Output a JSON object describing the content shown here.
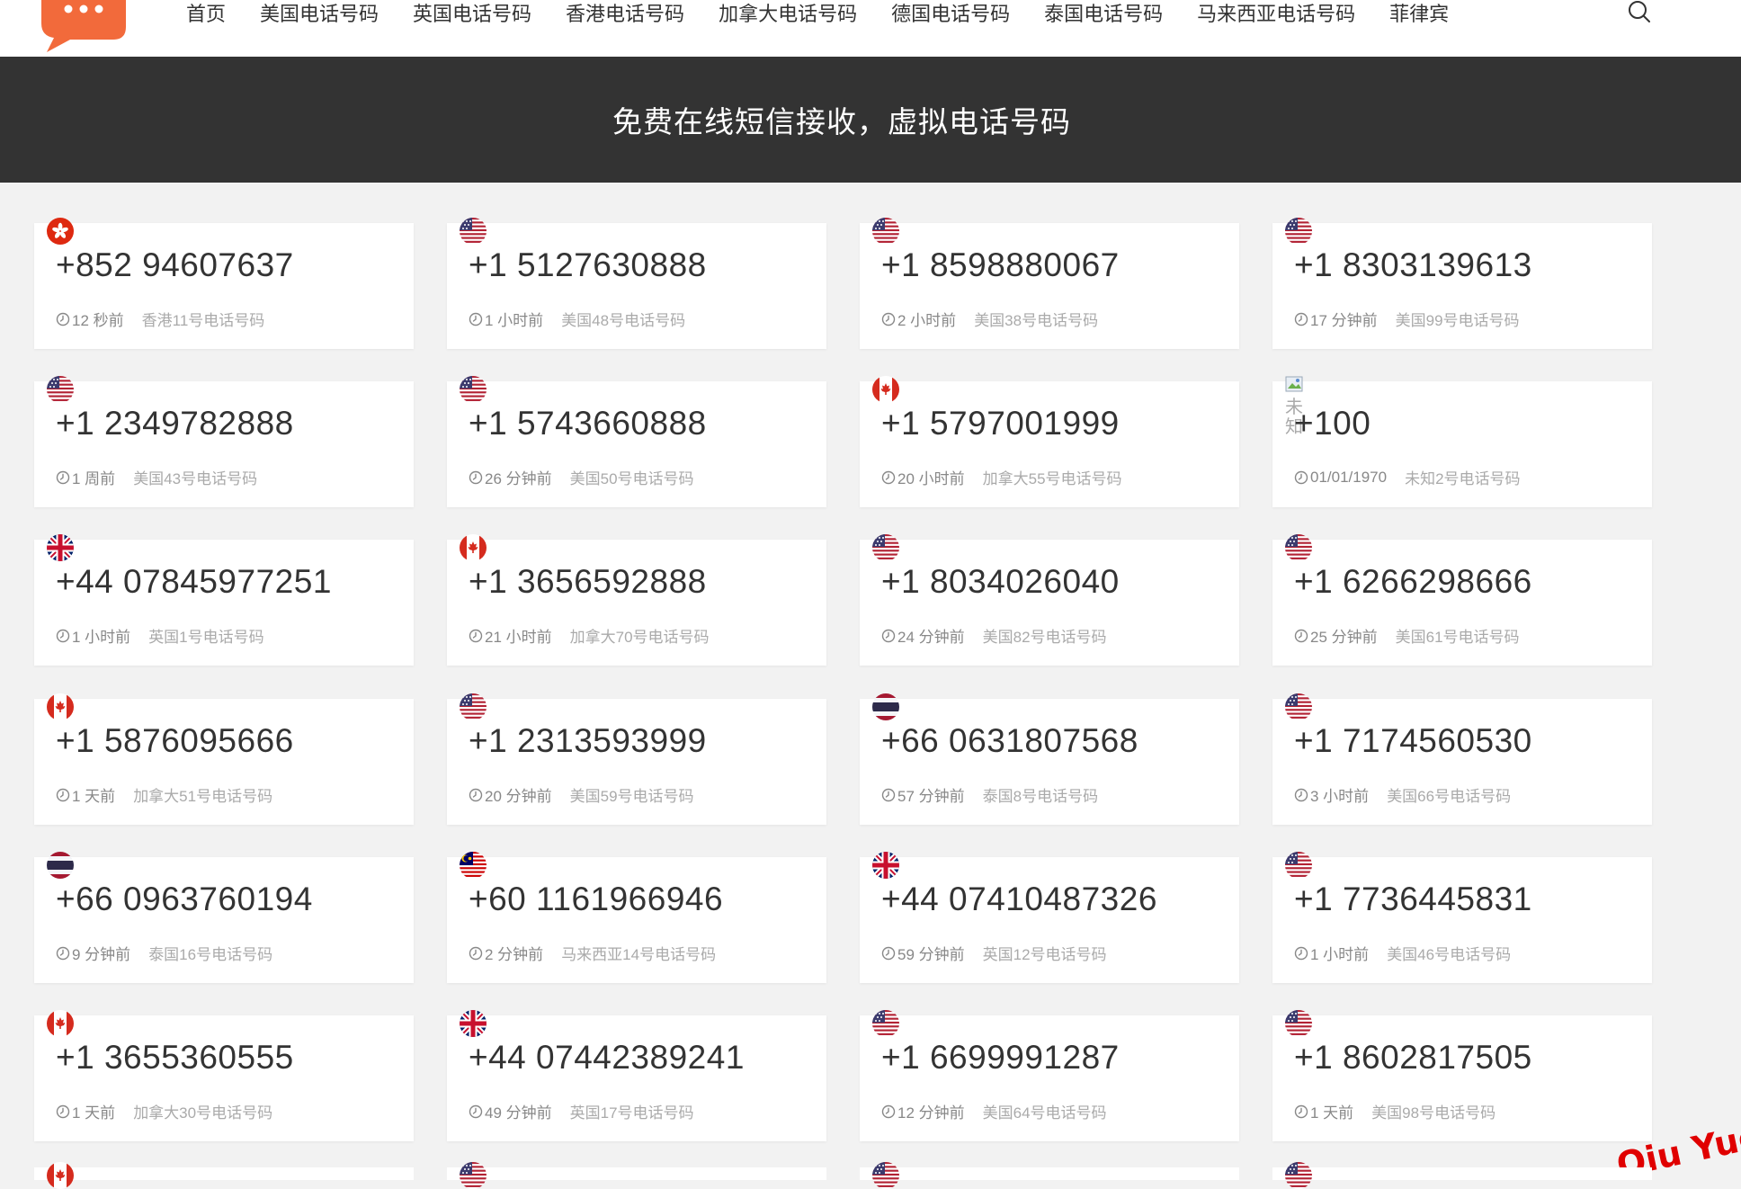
{
  "nav": {
    "items": [
      "首页",
      "美国电话号码",
      "英国电话号码",
      "香港电话号码",
      "加拿大电话号码",
      "德国电话号码",
      "泰国电话号码",
      "马来西亚电话号码",
      "菲律宾"
    ]
  },
  "banner": {
    "title": "免费在线短信接收，虚拟电话号码"
  },
  "cards": [
    {
      "flag": "hk-flag-icon",
      "number": "+852 94607637",
      "time": "12 秒前",
      "label": "香港11号电话号码"
    },
    {
      "flag": "us-flag-icon",
      "number": "+1 5127630888",
      "time": "1 小时前",
      "label": "美国48号电话号码"
    },
    {
      "flag": "us-flag-icon",
      "number": "+1 8598880067",
      "time": "2 小时前",
      "label": "美国38号电话号码"
    },
    {
      "flag": "us-flag-icon",
      "number": "+1 8303139613",
      "time": "17 分钟前",
      "label": "美国99号电话号码"
    },
    {
      "flag": "us-flag-icon",
      "number": "+1 2349782888",
      "time": "1 周前",
      "label": "美国43号电话号码"
    },
    {
      "flag": "us-flag-icon",
      "number": "+1 5743660888",
      "time": "26 分钟前",
      "label": "美国50号电话号码"
    },
    {
      "flag": "ca-flag-icon",
      "number": "+1 5797001999",
      "time": "20 小时前",
      "label": "加拿大55号电话号码"
    },
    {
      "flag": "unknown-flag-icon",
      "number": "+100",
      "time": "01/01/1970",
      "label": "未知2号电话号码",
      "flag_alt": "未知"
    },
    {
      "flag": "uk-flag-icon",
      "number": "+44 07845977251",
      "time": "1 小时前",
      "label": "英国1号电话号码"
    },
    {
      "flag": "ca-flag-icon",
      "number": "+1 3656592888",
      "time": "21 小时前",
      "label": "加拿大70号电话号码"
    },
    {
      "flag": "us-flag-icon",
      "number": "+1 8034026040",
      "time": "24 分钟前",
      "label": "美国82号电话号码"
    },
    {
      "flag": "us-flag-icon",
      "number": "+1 6266298666",
      "time": "25 分钟前",
      "label": "美国61号电话号码"
    },
    {
      "flag": "ca-flag-icon",
      "number": "+1 5876095666",
      "time": "1 天前",
      "label": "加拿大51号电话号码"
    },
    {
      "flag": "us-flag-icon",
      "number": "+1 2313593999",
      "time": "20 分钟前",
      "label": "美国59号电话号码"
    },
    {
      "flag": "th-flag-icon",
      "number": "+66 0631807568",
      "time": "57 分钟前",
      "label": "泰国8号电话号码"
    },
    {
      "flag": "us-flag-icon",
      "number": "+1 7174560530",
      "time": "3 小时前",
      "label": "美国66号电话号码"
    },
    {
      "flag": "th-flag-icon",
      "number": "+66 0963760194",
      "time": "9 分钟前",
      "label": "泰国16号电话号码"
    },
    {
      "flag": "my-flag-icon",
      "number": "+60 1161966946",
      "time": "2 分钟前",
      "label": "马来西亚14号电话号码"
    },
    {
      "flag": "uk-flag-icon",
      "number": "+44 07410487326",
      "time": "59 分钟前",
      "label": "英国12号电话号码"
    },
    {
      "flag": "us-flag-icon",
      "number": "+1 7736445831",
      "time": "1 小时前",
      "label": "美国46号电话号码"
    },
    {
      "flag": "ca-flag-icon",
      "number": "+1 3655360555",
      "time": "1 天前",
      "label": "加拿大30号电话号码"
    },
    {
      "flag": "uk-flag-icon",
      "number": "+44 07442389241",
      "time": "49 分钟前",
      "label": "英国17号电话号码"
    },
    {
      "flag": "us-flag-icon",
      "number": "+1 6699991287",
      "time": "12 分钟前",
      "label": "美国64号电话号码"
    },
    {
      "flag": "us-flag-icon",
      "number": "+1 8602817505",
      "time": "1 天前",
      "label": "美国98号电话号码"
    }
  ],
  "partial_row_flags": [
    "ca-flag-icon",
    "us-flag-icon",
    "us-flag-icon",
    "us-flag-icon"
  ],
  "watermark": {
    "text": "Qiu Yue"
  },
  "colors": {
    "banner_bg": "#333333",
    "logo": "#f26a3b",
    "watermark": "#e00000"
  }
}
